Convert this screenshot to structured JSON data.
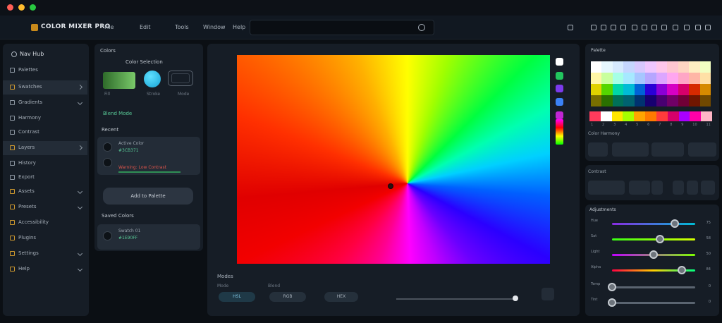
{
  "app": {
    "title": "COLOR MIXER PRO"
  },
  "menu": {
    "items": [
      "File",
      "Edit",
      "Tools",
      "Window",
      "Help"
    ]
  },
  "search": {
    "placeholder": ""
  },
  "sidebar": {
    "header": "Nav Hub",
    "items": [
      {
        "label": "Palettes"
      },
      {
        "label": "Swatches"
      },
      {
        "label": "Gradients"
      },
      {
        "label": "Harmony"
      },
      {
        "label": "Contrast"
      },
      {
        "label": "Layers"
      },
      {
        "label": "History"
      },
      {
        "label": "Export"
      },
      {
        "label": "Assets"
      },
      {
        "label": "Presets"
      },
      {
        "label": "Accessibility"
      },
      {
        "label": "Plugins"
      },
      {
        "label": "Settings"
      },
      {
        "label": "Help"
      }
    ]
  },
  "color_panel": {
    "title": "Colors",
    "mode_title": "Color Selection",
    "swatch_labels": [
      "Fill",
      "Stroke",
      "Mode"
    ],
    "option_label": "Blend Mode",
    "recent_title": "Recent",
    "card1_line1": "Active Color",
    "card1_value": "#3CB371",
    "card2_line": "Warning: Low Contrast",
    "button_label": "Add to Palette",
    "saved_title": "Saved Colors",
    "card3_line1": "Swatch 01",
    "card3_line2": "#1E90FF"
  },
  "canvas": {
    "footer_title": "Modes",
    "mode_labels": [
      "Mode",
      "Blend"
    ],
    "pills": [
      "HSL",
      "RGB",
      "HEX"
    ],
    "colors": [
      "#ffffff",
      "#22c55e",
      "#7c3aed",
      "#3b82f6",
      "#c026d3"
    ]
  },
  "right_panel": {
    "palette_title": "Palette",
    "harmony_title": "Color Harmony",
    "contrast_title": "Contrast",
    "adjust_title": "Adjustments",
    "strip_numbers": [
      "1",
      "2",
      "3",
      "4",
      "5",
      "6",
      "7",
      "8",
      "9",
      "10",
      "11"
    ],
    "sliders": [
      {
        "label": "Hue",
        "value": "75"
      },
      {
        "label": "Sat",
        "value": "58"
      },
      {
        "label": "Light",
        "value": "50"
      },
      {
        "label": "Alpha",
        "value": "84"
      },
      {
        "label": "Temp",
        "value": "0"
      },
      {
        "label": "Tint",
        "value": "0"
      }
    ]
  }
}
